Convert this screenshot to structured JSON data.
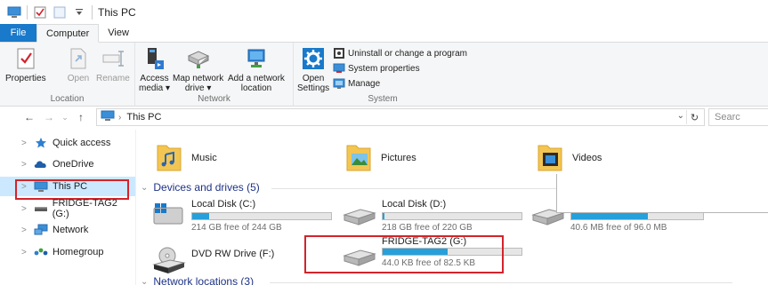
{
  "window": {
    "title": "This PC"
  },
  "ribbon_tabs": [
    {
      "label": "File"
    },
    {
      "label": "Computer"
    },
    {
      "label": "View"
    }
  ],
  "ribbon": {
    "location": {
      "label": "Location",
      "properties": "Properties",
      "open": "Open",
      "rename": "Rename"
    },
    "network": {
      "label": "Network",
      "access_media_1": "Access",
      "access_media_2": "media ▾",
      "map_drive_1": "Map network",
      "map_drive_2": "drive ▾",
      "add_location_1": "Add a network",
      "add_location_2": "location"
    },
    "system": {
      "label": "System",
      "open_settings_1": "Open",
      "open_settings_2": "Settings",
      "uninstall": "Uninstall or change a program",
      "system_properties": "System properties",
      "manage": "Manage"
    }
  },
  "address_bar": {
    "path": "This PC",
    "search_placeholder": "Searc"
  },
  "nav_pane": {
    "items": [
      {
        "label": "Quick access"
      },
      {
        "label": "OneDrive"
      },
      {
        "label": "This PC"
      },
      {
        "label": "FRIDGE-TAG2 (G:)"
      },
      {
        "label": "Network"
      },
      {
        "label": "Homegroup"
      }
    ]
  },
  "folders": [
    {
      "label": "Music"
    },
    {
      "label": "Pictures"
    },
    {
      "label": "Videos"
    }
  ],
  "sections": {
    "devices": "Devices and drives (5)",
    "network": "Network locations (3)"
  },
  "drives": [
    {
      "name": "Local Disk (C:)",
      "free": "214 GB free of 244 GB",
      "used_fraction": 0.12
    },
    {
      "name": "Local Disk (D:)",
      "free": "218 GB free of 220 GB",
      "used_fraction": 0.01
    },
    {
      "name": "",
      "free": "40.6 MB free of 96.0 MB",
      "used_fraction": 0.58
    },
    {
      "name": "DVD RW Drive (F:)",
      "free": ""
    },
    {
      "name": "FRIDGE-TAG2 (G:)",
      "free": "44.0 KB free of 82.5 KB",
      "used_fraction": 0.47
    }
  ],
  "colors": {
    "accent": "#1979ca",
    "bar_fill": "#26a0da",
    "section_text": "#1e3287",
    "highlight": "#d4232b"
  }
}
